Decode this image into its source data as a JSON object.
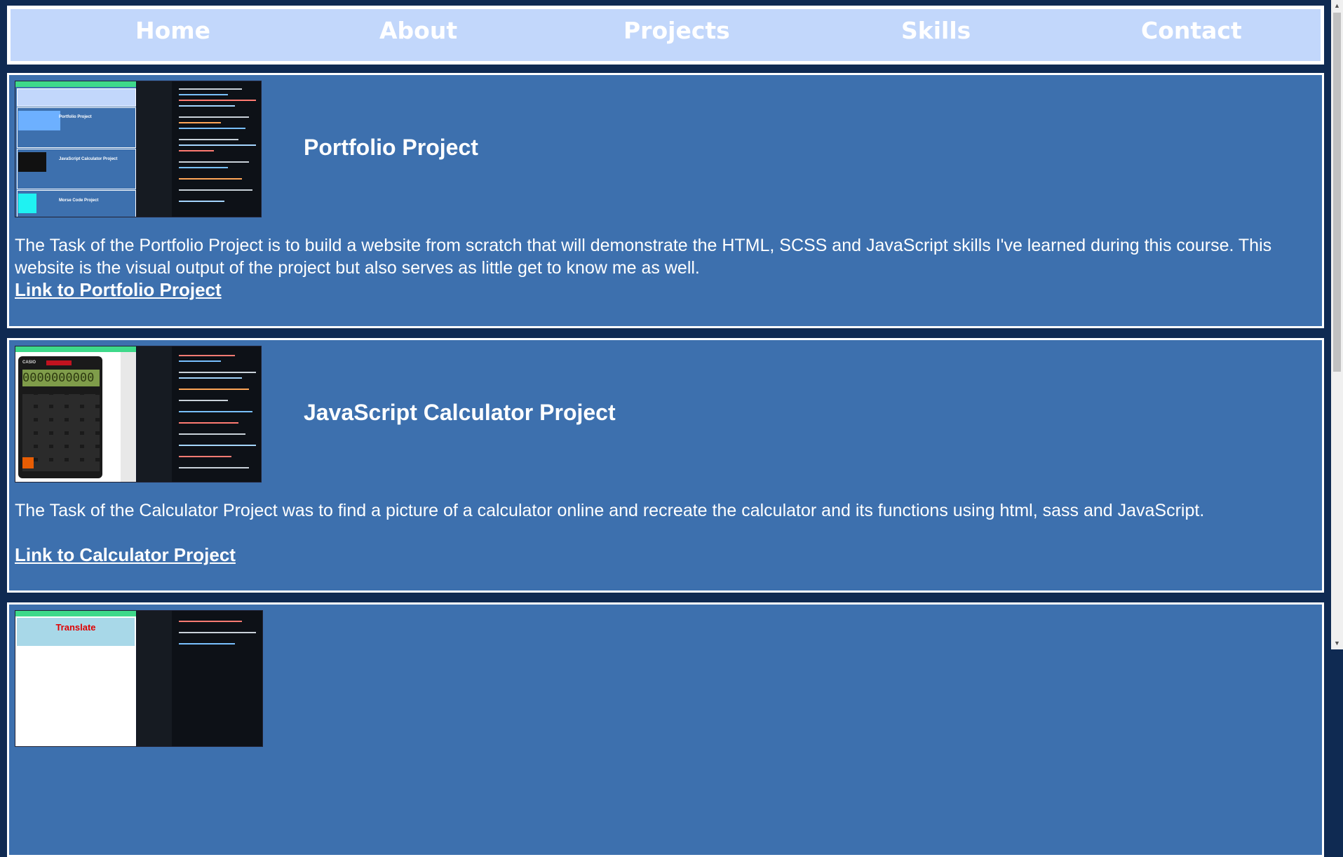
{
  "nav": {
    "items": [
      {
        "label": "Home"
      },
      {
        "label": "About"
      },
      {
        "label": "Projects"
      },
      {
        "label": "Skills"
      },
      {
        "label": "Contact"
      }
    ]
  },
  "projects": [
    {
      "title": "Portfolio Project",
      "description": "The Task of the Portfolio Project is to build a website from scratch that will demonstrate the HTML, SCSS and JavaScript skills I've learned during this course. This website is the visual output of the project but also serves as little get to know me as well.",
      "link_label": "Link to Portfolio Project"
    },
    {
      "title": "JavaScript Calculator Project",
      "description": "The Task of the Calculator Project was to find a picture of a calculator online and recreate the calculator and its functions using html, sass and JavaScript.",
      "link_label": "Link to Calculator Project"
    },
    {
      "title": "",
      "description": "",
      "link_label": "",
      "thumbnail_text": "Translate"
    }
  ],
  "thumb_text": {
    "portfolio_small_1": "Portfolio Project",
    "portfolio_small_2": "JavaScript Calculator Project",
    "portfolio_small_3": "Morse Code Project",
    "calc_display": "0000000000",
    "calc_brand": "CASIO"
  },
  "colors": {
    "background": "#0f2a52",
    "nav": "#c2d7fb",
    "card": "#3d70ae",
    "text": "#ffffff"
  }
}
